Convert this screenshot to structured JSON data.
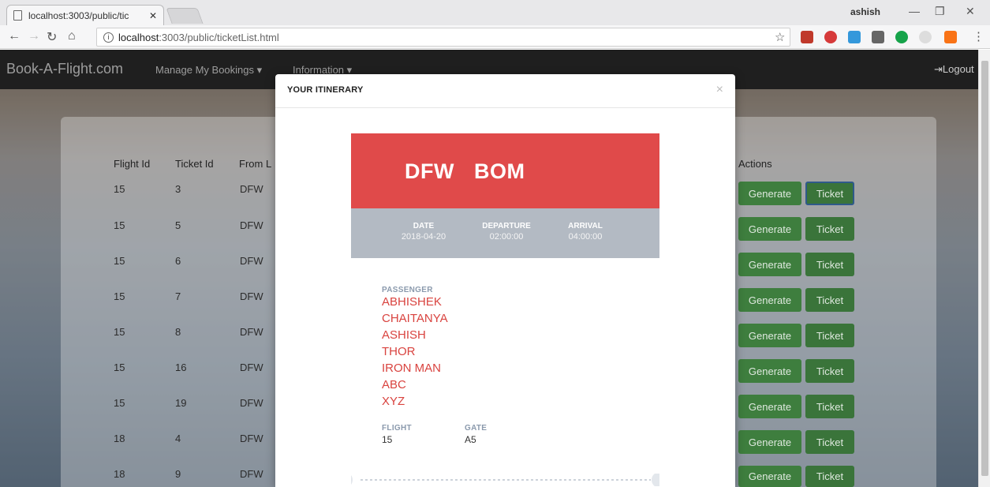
{
  "browser": {
    "tab_title": "localhost:3003/public/tic",
    "url_host": "localhost",
    "url_rest": ":3003/public/ticketList.html",
    "user_name": "ashish"
  },
  "navbar": {
    "brand": "Book-A-Flight.com",
    "manage": "Manage My Bookings ▾",
    "information": "Information ▾",
    "logout": "Logout"
  },
  "table": {
    "headers": [
      "Flight Id",
      "Ticket Id",
      "From L",
      "Actions"
    ],
    "rows": [
      {
        "flight": "15",
        "ticket": "3",
        "from": "DFW"
      },
      {
        "flight": "15",
        "ticket": "5",
        "from": "DFW"
      },
      {
        "flight": "15",
        "ticket": "6",
        "from": "DFW"
      },
      {
        "flight": "15",
        "ticket": "7",
        "from": "DFW"
      },
      {
        "flight": "15",
        "ticket": "8",
        "from": "DFW"
      },
      {
        "flight": "15",
        "ticket": "16",
        "from": "DFW"
      },
      {
        "flight": "15",
        "ticket": "19",
        "from": "DFW"
      },
      {
        "flight": "18",
        "ticket": "4",
        "from": "DFW"
      },
      {
        "flight": "18",
        "ticket": "9",
        "from": "DFW"
      }
    ],
    "generate_label": "Generate",
    "ticket_label": "Ticket"
  },
  "modal": {
    "title": "YOUR ITINERARY",
    "close": "×",
    "from": "DFW",
    "to": "BOM",
    "date_label": "DATE",
    "date": "2018-04-20",
    "departure_label": "DEPARTURE",
    "departure": "02:00:00",
    "arrival_label": "ARRIVAL",
    "arrival": "04:00:00",
    "passenger_label": "PASSENGER",
    "passengers": [
      "ABHISHEK",
      "CHAITANYA",
      "ASHISH",
      "THOR",
      "IRON MAN",
      "ABC",
      "XYZ"
    ],
    "flight_label": "FLIGHT",
    "flight": "15",
    "gate_label": "GATE",
    "gate": "A5"
  },
  "colors": {
    "ticket_red": "#e04a4a",
    "ticket_grey": "#b3bac3",
    "passenger_red": "#d9433f",
    "button_green": "#3e7e3e"
  }
}
